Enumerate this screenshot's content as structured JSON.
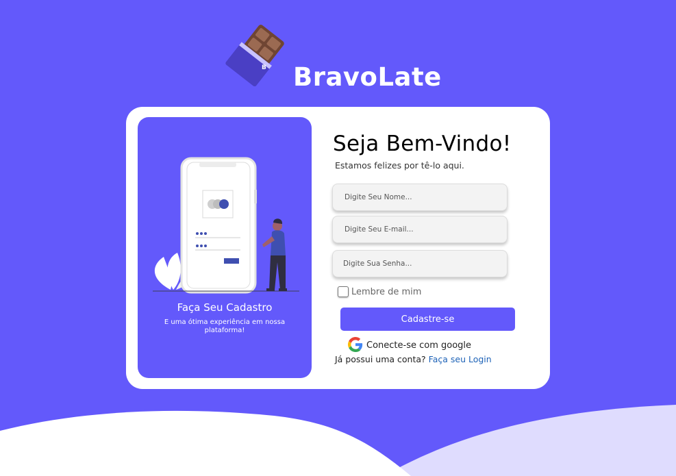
{
  "brand": {
    "name": "BravoLate",
    "logo_icon": "chocolate-bar-icon",
    "logo_badge_letter": "B"
  },
  "colors": {
    "background": "#6359fb",
    "card": "#ffffff",
    "accent": "#6359fb",
    "link": "#1d62b7",
    "wave_light": "#dfdcfe"
  },
  "left_panel": {
    "illustration": "phone-signup-illustration",
    "title": "Faça Seu Cadastro",
    "subtitle": "E uma ótima experiência em nossa plataforma!"
  },
  "form": {
    "heading": "Seja Bem-Vindo!",
    "tagline": "Estamos felizes por tê-lo aqui.",
    "name_placeholder": "Digite Seu Nome...",
    "email_placeholder": "Digite Seu E-mail...",
    "password_placeholder": "Digite Sua Senha...",
    "remember_label": "Lembre de mim",
    "remember_checked": false,
    "submit_label": "Cadastre-se",
    "google_label": "Conecte-se com google",
    "google_icon": "google-icon",
    "have_account_text": "Já possui uma conta?",
    "login_link": "Faça seu Login"
  }
}
